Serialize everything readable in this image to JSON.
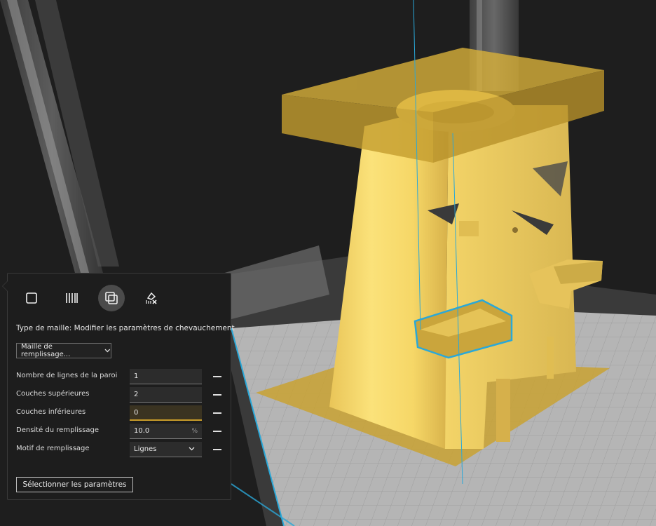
{
  "panel": {
    "mesh_type_label": "Type de maille: Modifier les paramètres de chevauchement",
    "mesh_dropdown_value": "Maille de remplissage...",
    "settings": [
      {
        "label": "Nombre de lignes de la paroi",
        "value": "1"
      },
      {
        "label": "Couches supérieures",
        "value": "2"
      },
      {
        "label": "Couches inférieures",
        "value": "0"
      },
      {
        "label": "Densité du remplissage",
        "value": "10.0",
        "unit": "%"
      },
      {
        "label": "Motif de remplissage",
        "value": "Lignes"
      }
    ],
    "select_settings_label": "Sélectionner les paramètres"
  },
  "colors": {
    "accent_model": "#f5d66a",
    "selection_outline": "#2aa8d8",
    "highlight_field_border": "#c89c2a"
  },
  "icons": {
    "mesh_type_buttons": [
      "normal-model-icon",
      "support-mesh-icon",
      "overlap-mesh-icon",
      "anti-overhang-icon"
    ]
  }
}
